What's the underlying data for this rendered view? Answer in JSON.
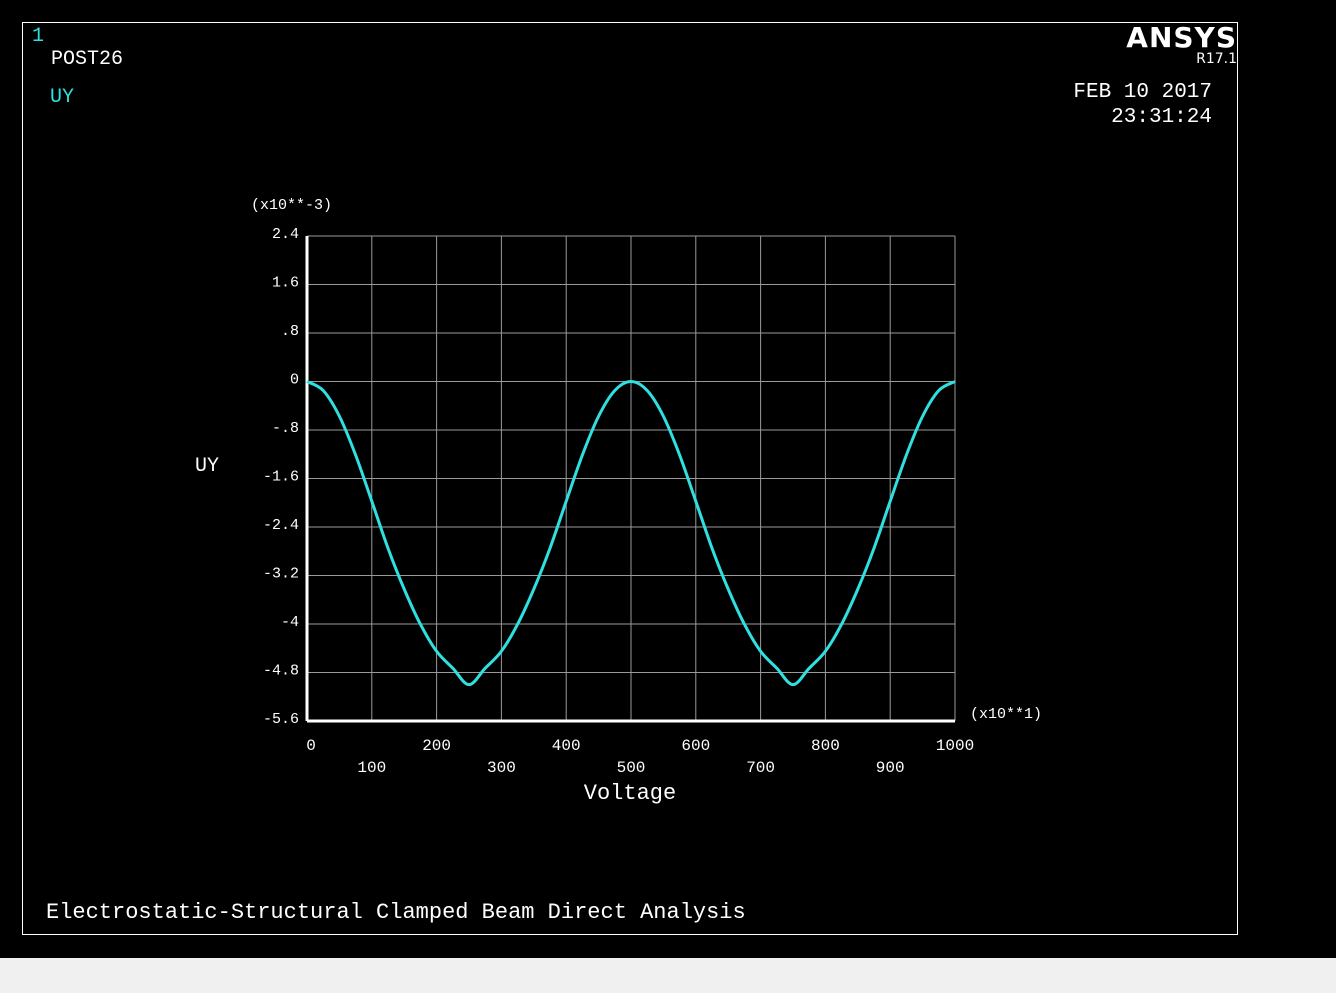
{
  "window": {
    "number": "1",
    "processor": "POST26",
    "variable": "UY"
  },
  "branding": {
    "logo": "ANSYS",
    "release": "R17.1"
  },
  "timestamp": {
    "date": "FEB 10 2017",
    "time": "23:31:24"
  },
  "footer": {
    "title": "Electrostatic-Structural Clamped Beam Direct Analysis"
  },
  "colors": {
    "background": "#000000",
    "curve": "#30e0e0",
    "grid": "#9a9a9a",
    "axis": "#ffffff",
    "text": "#ffffff"
  },
  "chart_data": {
    "type": "line",
    "xlabel": "Voltage",
    "ylabel": "UY",
    "x_multiplier": "(x10**1)",
    "y_multiplier": "(x10**-3)",
    "xlim": [
      0,
      1000
    ],
    "ylim": [
      -5.6,
      2.4
    ],
    "x_ticks": [
      0,
      100,
      200,
      300,
      400,
      500,
      600,
      700,
      800,
      900,
      1000
    ],
    "x_tick_labels": [
      "0",
      "100",
      "200",
      "300",
      "400",
      "500",
      "600",
      "700",
      "800",
      "900",
      "1000"
    ],
    "y_ticks": [
      2.4,
      1.6,
      0.8,
      0,
      -0.8,
      -1.6,
      -2.4,
      -3.2,
      -4,
      -4.8,
      -5.6
    ],
    "y_tick_labels": [
      "2.4",
      "1.6",
      ".8",
      "0",
      "-.8",
      "-1.6",
      "-2.4",
      "-3.2",
      "-4",
      "-4.8",
      "-5.6"
    ],
    "grid": true,
    "series": [
      {
        "x": [
          0,
          25,
          50,
          75,
          100,
          125,
          150,
          175,
          200,
          225,
          250,
          275,
          300,
          325,
          350,
          375,
          400,
          425,
          450,
          475,
          500,
          525,
          550,
          575,
          600,
          625,
          650,
          675,
          700,
          725,
          750,
          775,
          800,
          825,
          850,
          875,
          900,
          925,
          950,
          975,
          1000
        ],
        "y": [
          0,
          -0.149,
          -0.573,
          -1.212,
          -1.975,
          -2.75,
          -3.425,
          -4.004,
          -4.45,
          -4.729,
          -5.0,
          -4.729,
          -4.45,
          -4.004,
          -3.425,
          -2.75,
          -1.975,
          -1.212,
          -0.573,
          -0.149,
          0,
          -0.149,
          -0.573,
          -1.212,
          -1.975,
          -2.75,
          -3.425,
          -4.004,
          -4.45,
          -4.729,
          -5.0,
          -4.729,
          -4.45,
          -4.004,
          -3.425,
          -2.75,
          -1.975,
          -1.212,
          -0.573,
          -0.149,
          0
        ]
      }
    ]
  }
}
